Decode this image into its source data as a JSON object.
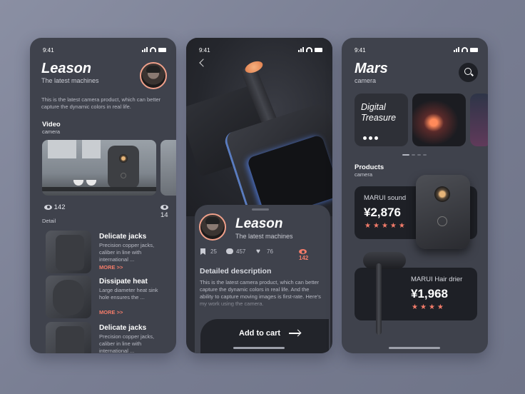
{
  "screen1": {
    "time": "9:41",
    "title": "Leason",
    "subtitle": "The latest machines",
    "description": "This is the latest camera product, which can better capture the dynamic colors in real life.",
    "video_label": "Video",
    "video_sub": "camera",
    "views": "142",
    "views_second": "14",
    "detail_label": "Detail",
    "details": [
      {
        "title": "Delicate jacks",
        "desc": "Precision copper jacks, caliber in line with international ...",
        "more": "MORE >>"
      },
      {
        "title": "Dissipate heat",
        "desc": "Large diameter heat sink hole ensures the ...",
        "more": "MORE >>"
      },
      {
        "title": "Delicate jacks",
        "desc": "Precision copper jacks, caliber in line with international ...",
        "more": ""
      }
    ]
  },
  "screen2": {
    "time": "9:41",
    "title": "Leason",
    "subtitle": "The latest machines",
    "bookmarks": "25",
    "comments": "457",
    "likes": "76",
    "views": "142",
    "desc_title": "Detailed description",
    "description": "This is the latest camera product, which can better capture the dynamic colors in real life. And the ability to capture moving images is first-rate. Here's my work using the camera.",
    "cart_label": "Add to cart"
  },
  "screen3": {
    "time": "9:41",
    "title": "Mars",
    "subtitle": "camera",
    "tile_text": "Digital Treasure",
    "products_label": "Products",
    "products_sub": "camera",
    "products": [
      {
        "name": "MARUI sound",
        "price": "¥2,876",
        "stars": 5
      },
      {
        "name": "MARUI Hair drier",
        "price": "¥1,968",
        "stars": 4
      }
    ]
  },
  "colors": {
    "accent": "#f47c6a",
    "card": "#3f424c",
    "dark": "#1e2026"
  }
}
